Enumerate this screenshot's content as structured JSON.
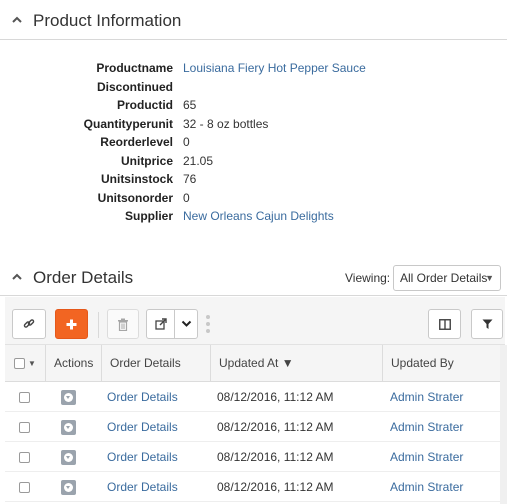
{
  "product_section": {
    "title": "Product Information",
    "fields": [
      {
        "label": "Productname",
        "value": "Louisiana Fiery Hot Pepper Sauce",
        "link": true
      },
      {
        "label": "Discontinued",
        "value": "",
        "link": false
      },
      {
        "label": "Productid",
        "value": "65",
        "link": false
      },
      {
        "label": "Quantityperunit",
        "value": "32 - 8 oz bottles",
        "link": false
      },
      {
        "label": "Reorderlevel",
        "value": "0",
        "link": false
      },
      {
        "label": "Unitprice",
        "value": "21.05",
        "link": false
      },
      {
        "label": "Unitsinstock",
        "value": "76",
        "link": false
      },
      {
        "label": "Unitsonorder",
        "value": "0",
        "link": false
      },
      {
        "label": "Supplier",
        "value": "New Orleans Cajun Delights",
        "link": true
      }
    ]
  },
  "order_section": {
    "title": "Order Details",
    "viewing_label": "Viewing:",
    "viewing_value": "All Order Details",
    "toolbar": {
      "link_icon": "link-icon",
      "add_icon": "plus-icon",
      "delete_icon": "trash-icon",
      "export_icon": "external-link-icon",
      "dropdown_icon": "chevron-down-icon",
      "columns_icon": "columns-icon",
      "filter_icon": "filter-icon"
    },
    "columns": {
      "actions": "Actions",
      "order_details": "Order Details",
      "updated_at": "Updated At ▼",
      "updated_by": "Updated By"
    },
    "rows": [
      {
        "order_details": "Order Details",
        "updated_at": "08/12/2016, 11:12 AM",
        "updated_by": "Admin Strater"
      },
      {
        "order_details": "Order Details",
        "updated_at": "08/12/2016, 11:12 AM",
        "updated_by": "Admin Strater"
      },
      {
        "order_details": "Order Details",
        "updated_at": "08/12/2016, 11:12 AM",
        "updated_by": "Admin Strater"
      },
      {
        "order_details": "Order Details",
        "updated_at": "08/12/2016, 11:12 AM",
        "updated_by": "Admin Strater"
      }
    ]
  },
  "colors": {
    "link": "#3a6b9e",
    "accent": "#f26522"
  }
}
